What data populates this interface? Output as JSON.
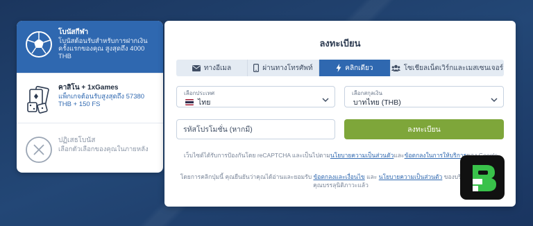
{
  "bonuses": [
    {
      "title": "โบนัสกีฬา",
      "desc": "โบนัสต้อนรับสำหรับการฝากเงินครั้งแรกของคุณ สูงสุดถึง 4000 THB",
      "icon": "soccer-ball-icon"
    },
    {
      "title": "คาสิโน + 1xGames",
      "desc": "แพ็กเกจต้อนรับสูงสุดถึง 57380 THB + 150 FS",
      "icon": "cards-dice-icon"
    },
    {
      "title": "ปฏิเสธโบนัส",
      "desc": "เลือกตัวเลือกของคุณในภายหลัง",
      "icon": "close-circle-icon"
    }
  ],
  "registration": {
    "title": "ลงทะเบียน",
    "tabs": [
      {
        "label": "ทางอีเมล",
        "icon": "envelope-icon"
      },
      {
        "label": "ผ่านทางโทรศัพท์",
        "icon": "phone-icon"
      },
      {
        "label": "คลิกเดียว",
        "icon": "lightning-icon"
      },
      {
        "label": "โซเชียลเน็ตเวิร์กและเมสเซนเจอร์",
        "icon": "users-icon"
      }
    ],
    "country": {
      "label": "เลือกประเทศ",
      "value": "ไทย"
    },
    "currency": {
      "label": "เลือกสกุลเงิน",
      "value": "บาทไทย (THB)"
    },
    "promo_placeholder": "รหัสโปรโมชั่น (หากมี)",
    "submit_label": "ลงทะเบียน",
    "recaptcha": {
      "prefix": "เว็บไซต์ได้รับการป้องกันโดย reCAPTCHA และเป็นไปตาม",
      "privacy_link": "นโยบายความเป็นส่วนตัว",
      "middle": "และ",
      "terms_link": "ข้อตกลงในการให้บริการ",
      "suffix": "ของ Google"
    },
    "consent": {
      "prefix": "โดยการคลิกปุ่มนี้ คุณยืนยันว่าคุณได้อ่านและยอมรับ",
      "terms_link": "ข้อตกลงและเงื่อนไข",
      "middle": "และ",
      "privacy_link": "นโยบายความเป็นส่วนตัว",
      "suffix": "ของบริษัทและยืนยันว่าคุณบรรลุนิติภาวะแล้ว"
    }
  },
  "colors": {
    "accent": "#2f68b0",
    "submit": "#7ea63a",
    "background": "#1c3a63",
    "badge_green": "#39c24a"
  }
}
